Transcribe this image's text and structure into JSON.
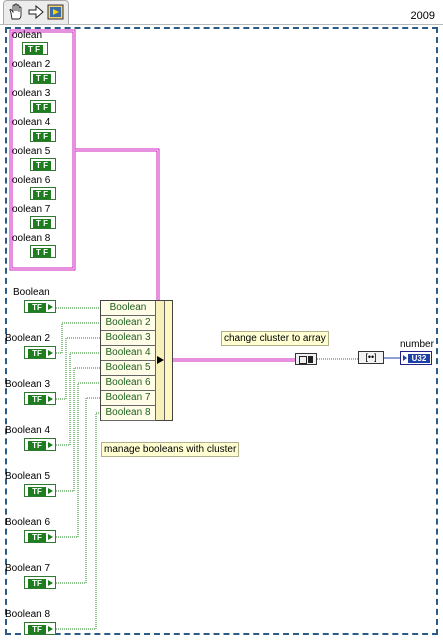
{
  "year": "2009",
  "toolbar": {
    "icons": [
      "hand-icon",
      "arrow-icon",
      "run-icon"
    ]
  },
  "cluster_indicator": {
    "labels": [
      "oolean",
      "oolean 2",
      "oolean 3",
      "oolean 4",
      "oolean 5",
      "oolean 6",
      "oolean 7",
      "oolean 8"
    ],
    "icon_text": "T F"
  },
  "boolean_controls": {
    "labels": [
      "Boolean",
      "Boolean 2",
      "Boolean 3",
      "Boolean 4",
      "Boolean 5",
      "Boolean 6",
      "Boolean 7",
      "Boolean 8"
    ],
    "icon_text": "TF"
  },
  "bundle": {
    "rows": [
      "Boolean",
      "Boolean 2",
      "Boolean 3",
      "Boolean 4",
      "Boolean 5",
      "Boolean 6",
      "Boolean 7",
      "Boolean 8"
    ]
  },
  "comments": {
    "change_cluster": "change cluster to array",
    "manage_booleans": "manage booleans with cluster"
  },
  "convert_node_text": "[••]",
  "number_indicator": {
    "label": "number",
    "type_text": "U32"
  },
  "colors": {
    "cluster_wire": "#d020c0",
    "boolean_wire": "#1f8a1f",
    "frame": "#2b5c88",
    "numeric": "#1f3fa5"
  }
}
